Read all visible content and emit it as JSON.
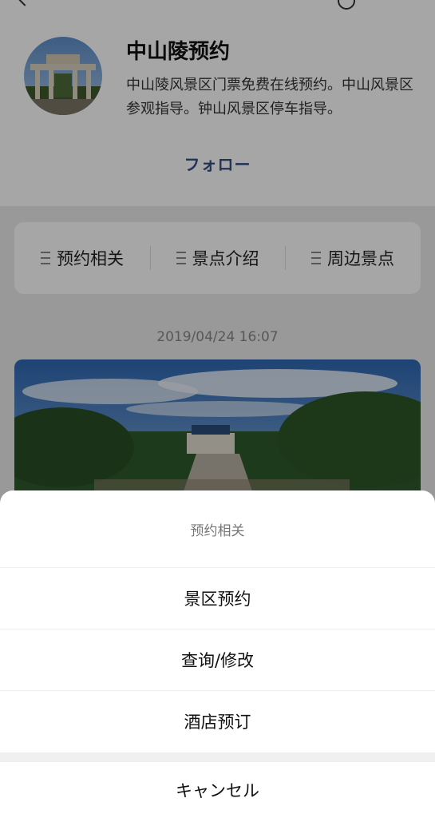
{
  "header": {
    "title": "中山陵预约",
    "description": "中山陵风景区门票免费在线预约。中山风景区参观指导。钟山风景区停车指导。",
    "follow_label": "フォロー"
  },
  "menu": {
    "items": [
      {
        "label": "预约相关"
      },
      {
        "label": "景点介绍"
      },
      {
        "label": "周边景点"
      }
    ]
  },
  "post": {
    "timestamp": "2019/04/24 16:07"
  },
  "action_sheet": {
    "title": "预约相关",
    "options": [
      {
        "label": "景区预约"
      },
      {
        "label": "查询/修改"
      },
      {
        "label": "酒店预订"
      }
    ],
    "cancel_label": "キャンセル"
  },
  "colors": {
    "follow": "#3a4d86",
    "overlay": "rgba(0,0,0,0.35)",
    "sheet_bg": "#ffffff"
  },
  "icons": [
    "back-icon",
    "search-icon",
    "menu-icon"
  ]
}
